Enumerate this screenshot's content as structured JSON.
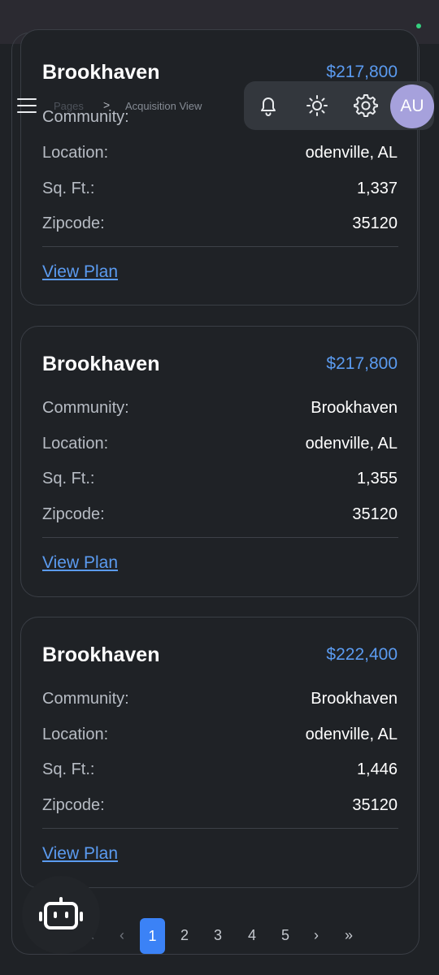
{
  "header": {
    "breadcrumb_pages": "Pages",
    "breadcrumb_separator": ">",
    "breadcrumb_current": "Acquisition View",
    "avatar_initials": "AU",
    "icons": [
      "menu-icon",
      "bell-icon",
      "sun-icon",
      "gear-icon"
    ]
  },
  "labels": {
    "community": "Community:",
    "location": "Location:",
    "sqft": "Sq. Ft.:",
    "zipcode": "Zipcode:",
    "view_plan": "View Plan"
  },
  "cards": [
    {
      "title": "Brookhaven",
      "price": "$217,800",
      "community": "",
      "location": "odenville, AL",
      "sqft": "1,337",
      "zipcode": "35120"
    },
    {
      "title": "Brookhaven",
      "price": "$217,800",
      "community": "Brookhaven",
      "location": "odenville, AL",
      "sqft": "1,355",
      "zipcode": "35120"
    },
    {
      "title": "Brookhaven",
      "price": "$222,400",
      "community": "Brookhaven",
      "location": "odenville, AL",
      "sqft": "1,446",
      "zipcode": "35120"
    }
  ],
  "pagination": {
    "first": "«",
    "prev": "‹",
    "pages": [
      "1",
      "2",
      "3",
      "4",
      "5"
    ],
    "current": "1",
    "next": "›",
    "last": "»"
  },
  "colors": {
    "background": "#1f2226",
    "accent": "#3b82f6",
    "link": "#5b9bf0",
    "avatar": "#a6a1dc"
  }
}
